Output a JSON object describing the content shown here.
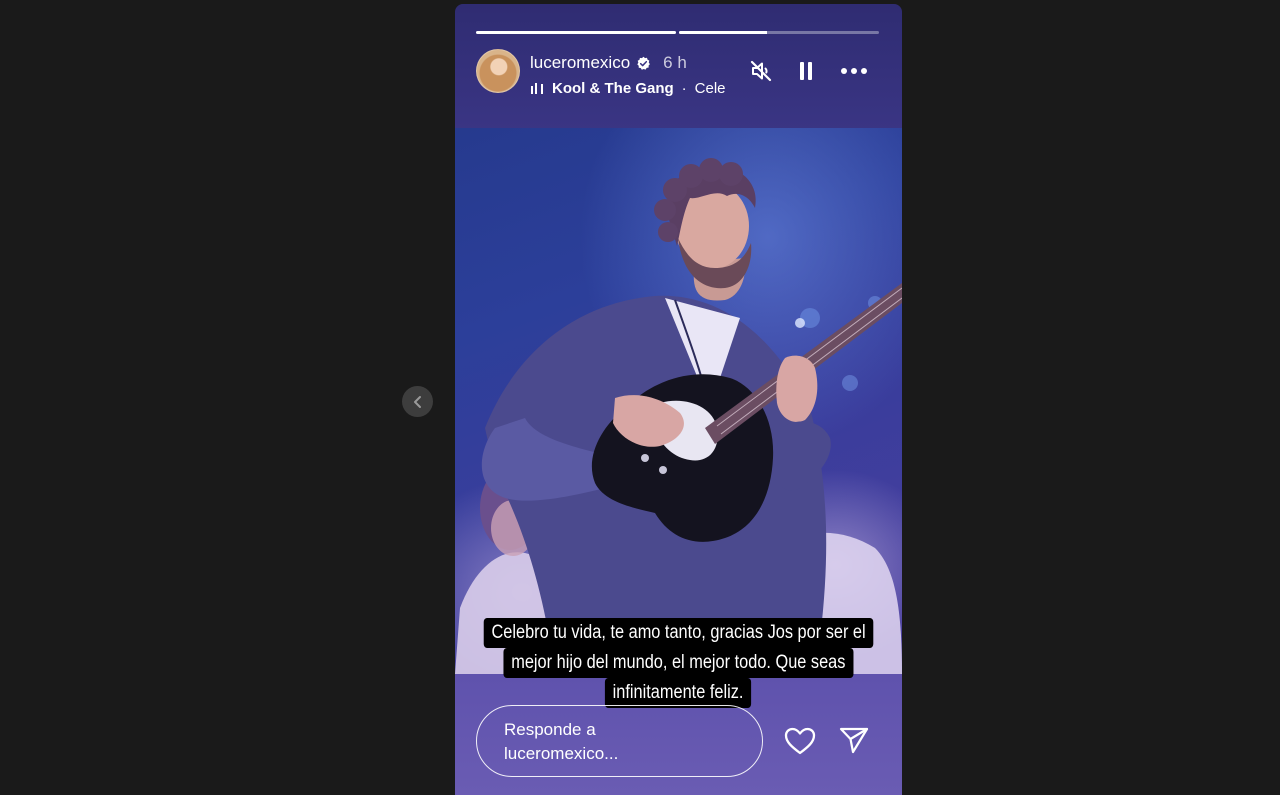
{
  "story": {
    "progress": [
      1.0,
      0.44
    ],
    "username": "luceromexico",
    "timestamp": "6 h",
    "music": {
      "artist": "Kool & The Gang",
      "separator": "·",
      "song": "Cele"
    },
    "caption_lines": [
      "Celebro tu vida, te amo tanto, gracias Jos por ser el",
      "mejor hijo del mundo, el mejor todo. Que seas",
      "infinitamente feliz."
    ],
    "reply": {
      "placeholder_line1": "Responde a",
      "placeholder_line2": "luceromexico..."
    }
  },
  "icons": {
    "prev": "chevron-left-icon",
    "verified": "verified-badge-icon",
    "music": "music-bars-icon",
    "mute": "speaker-muted-icon",
    "pause": "pause-icon",
    "more": "more-horizontal-icon",
    "like": "heart-icon",
    "share": "send-icon"
  },
  "colors": {
    "page_background": "#1a1a1a",
    "caption_background": "#000000"
  }
}
